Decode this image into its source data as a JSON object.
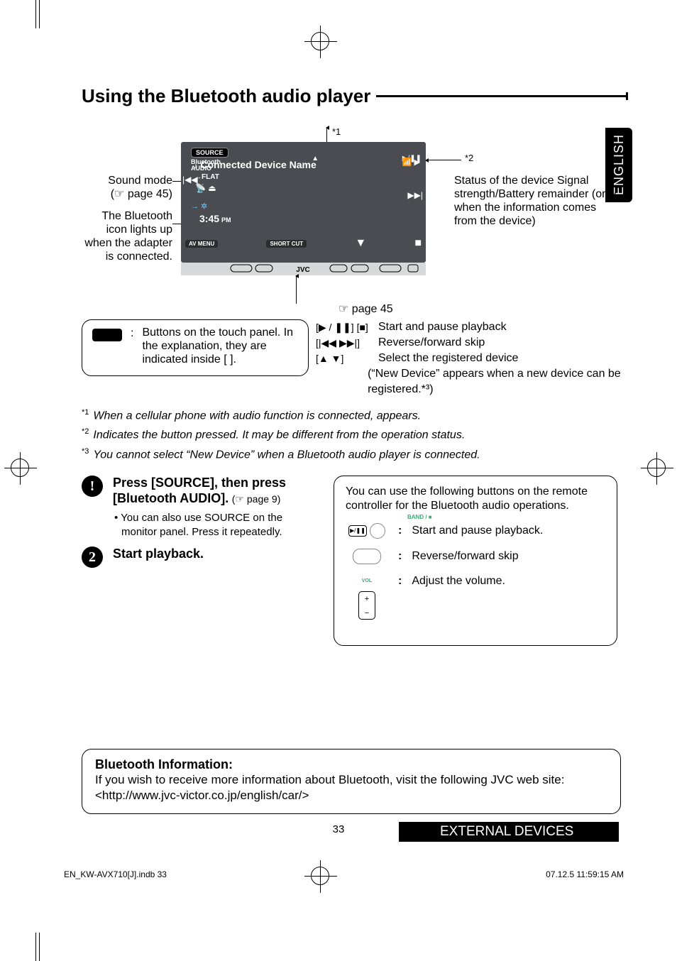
{
  "heading": "Using the Bluetooth audio player",
  "langTab": "ENGLISH",
  "diagram": {
    "star1": "*1",
    "star2": "*2",
    "leftLabel1a": "Sound mode",
    "leftLabel1b": "(☞ page 45)",
    "leftLabel2": "The Bluetooth icon lights up when the adapter is connected.",
    "rightLabel": "Status of the device Signal strength/Battery remainder (only when the information comes from the device)",
    "screen": {
      "source": "SOURCE",
      "btAudio1": "Bluetooth",
      "btAudio2": "AUDIO",
      "connected": "Connected Device Name",
      "flat": "FLAT",
      "time": "3:45",
      "ampm": "PM",
      "avmenu": "AV MENU",
      "shortcut": "SHORT CUT",
      "brand": "JVC"
    },
    "pageRef": "☞ page 45"
  },
  "touchBox": {
    "colon": ":",
    "text": "Buttons on the touch panel. In the explanation, they are indicated inside [       ]."
  },
  "controls": [
    {
      "sym": "[▶ / ❚❚] [■]",
      "desc": "Start and pause playback"
    },
    {
      "sym": "[|◀◀ ▶▶|]",
      "desc": "Reverse/forward skip"
    },
    {
      "sym": "[▲ ▼]",
      "desc": "Select the registered device"
    }
  ],
  "controlsExtra": "(“New Device” appears when a new device can be registered.*³)",
  "footnotes": [
    {
      "n": "*1",
      "t": "When a cellular phone with audio function is connected,      appears."
    },
    {
      "n": "*2",
      "t": "Indicates the button pressed. It may be different from the operation status."
    },
    {
      "n": "*3",
      "t": "You cannot select “New Device” when a Bluetooth audio player is connected."
    }
  ],
  "steps": {
    "s1a": "Press [SOURCE], then press [Bluetooth AUDIO].",
    "s1b": "(☞ page 9)",
    "s1c": "•  You can also use SOURCE on the monitor panel. Press it repeatedly.",
    "s2": "Start playback."
  },
  "remote": {
    "intro": "You can use the following buttons on the remote controller for the Bluetooth audio operations.",
    "band": "BAND / ■",
    "playSym": "▶/❚❚",
    "r1": "Start and pause playback.",
    "r2": "Reverse/forward skip",
    "volLabel": "VOL",
    "r3": "Adjust the volume."
  },
  "info": {
    "title": "Bluetooth Information:",
    "body": "If you wish to receive more information about Bluetooth, visit the following JVC web site: <http://www.jvc-victor.co.jp/english/car/>"
  },
  "pageNum": "33",
  "sectionBar": "EXTERNAL DEVICES",
  "indb": "EN_KW-AVX710[J].indb   33",
  "timestamp": "07.12.5   11:59:15 AM"
}
